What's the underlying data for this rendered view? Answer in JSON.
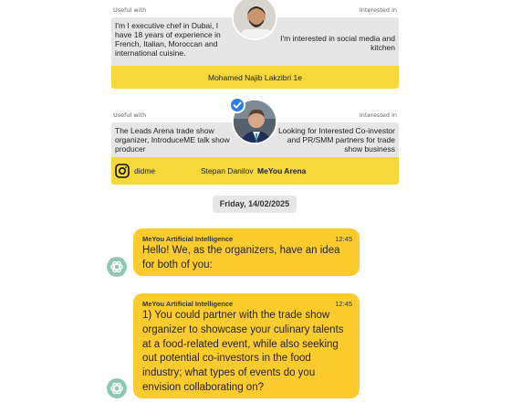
{
  "cards": [
    {
      "useful_with_label": "Useful with",
      "interested_in_label": "Interested in",
      "left_text": "I'm I executive chef in Dubai, I have 18 years of experience in French, Italian, Moroccan and international cuisine.",
      "right_text": "I'm interested in social media and kitchen",
      "name": "Mohamed Najib Lakzibri 1e"
    },
    {
      "useful_with_label": "Useful with",
      "interested_in_label": "Interested in",
      "left_text": "The Leads Arena trade show organizer, IntroduceME talk show producer",
      "right_text": "Looking for Interested Co-investor and PR/SMM partners for trade show business",
      "instagram_handle": "didme",
      "name": "Stepan Danilov",
      "company": "MeYou Arena"
    }
  ],
  "date_chip": "Friday, 14/02/2025",
  "messages": [
    {
      "sender": "MeYou Artificial Intelligence",
      "time": "12:45",
      "text": "Hello! We, as the organizers, have an idea for both of you:"
    },
    {
      "sender": "MeYou Artificial Intelligence",
      "time": "12:45",
      "text": "1) You could partner with the trade show organizer to showcase your culinary talents at a food-related event, while also seeking out potential co-investors in the food industry; what types of events do you envision collaborating on?"
    }
  ],
  "colors": {
    "card_bar": "#f6d83b",
    "bubble": "#fccc2e",
    "card_body": "#e6e6e6",
    "verified": "#2f7fe0",
    "ai_icon": "#8ec7b3"
  },
  "icons": [
    "chef-avatar",
    "stepan-avatar",
    "verified-badge-icon",
    "instagram-icon",
    "openai-logo-icon"
  ]
}
